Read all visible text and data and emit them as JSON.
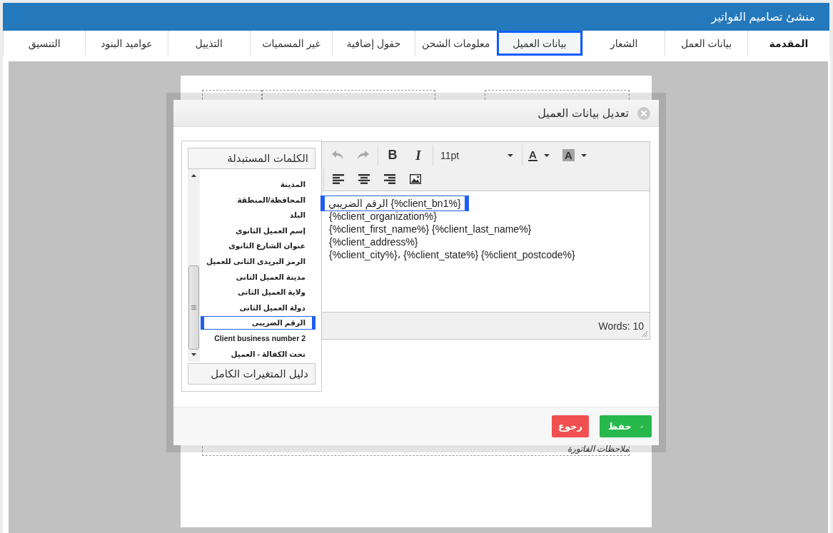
{
  "header": {
    "title": "منشئ تصاميم الفواتير"
  },
  "tabs": [
    {
      "label": "المقدمة",
      "kind": "heading",
      "selected": false
    },
    {
      "label": "بيانات العمل",
      "kind": "tab",
      "selected": false
    },
    {
      "label": "الشعار",
      "kind": "tab",
      "selected": false
    },
    {
      "label": "بيانات العميل",
      "kind": "tab",
      "selected": true
    },
    {
      "label": "معلومات الشحن",
      "kind": "tab",
      "selected": false
    },
    {
      "label": "حقول إضافية",
      "kind": "tab",
      "selected": false
    },
    {
      "label": "غير المسميات",
      "kind": "tab",
      "selected": false
    },
    {
      "label": "التذييل",
      "kind": "tab",
      "selected": false
    },
    {
      "label": "عواميد البنود",
      "kind": "tab",
      "selected": false
    },
    {
      "label": "التنسيق",
      "kind": "tab",
      "selected": false
    }
  ],
  "preview": {
    "notes_label": "ملاحظات الفاتورة"
  },
  "dialog": {
    "title": "تعديل بيانات العميل",
    "variables": {
      "heading": "الكلمات المستبدلة",
      "items": [
        {
          "label": "المدينة",
          "selected": false
        },
        {
          "label": "المحافظة/المنطقة",
          "selected": false
        },
        {
          "label": "البلد",
          "selected": false
        },
        {
          "label": "إسم العميل الثانوى",
          "selected": false
        },
        {
          "label": "عنوان الشارع الثانوى",
          "selected": false
        },
        {
          "label": "الرمز البريدى الثانى للعميل",
          "selected": false
        },
        {
          "label": "مدينة العميل الثانى",
          "selected": false
        },
        {
          "label": "ولاية العميل الثانى",
          "selected": false
        },
        {
          "label": "دولة العميل الثانى",
          "selected": false
        },
        {
          "label": "الرقم الضريبى",
          "selected": true
        },
        {
          "label": "Client business number 2",
          "selected": false
        },
        {
          "label": "تحت الكفالة - العميل",
          "selected": false
        }
      ],
      "guide_button": "دليل المتغيرات الكامل"
    },
    "editor": {
      "toolbar": [
        {
          "groups": [
            [
              {
                "kind": "background_color",
                "label": "A",
                "disabled": false
              },
              {
                "kind": "text_color",
                "label": "A",
                "disabled": false
              }
            ],
            [
              {
                "kind": "font_size",
                "value": "11pt",
                "disabled": false
              }
            ],
            [
              {
                "kind": "italic",
                "label": "I",
                "disabled": false
              },
              {
                "kind": "bold",
                "label": "B",
                "disabled": false
              }
            ],
            [
              {
                "kind": "redo",
                "disabled": true
              },
              {
                "kind": "undo",
                "disabled": true
              }
            ]
          ]
        },
        {
          "groups": [
            [
              {
                "kind": "image",
                "disabled": false
              },
              {
                "kind": "align_right",
                "disabled": false
              },
              {
                "kind": "align_center",
                "disabled": false
              },
              {
                "kind": "align_left",
                "disabled": false
              }
            ]
          ]
        }
      ],
      "lines": [
        {
          "text": "الرقم الضريبي {%client_bn1%}",
          "highlighted": true
        },
        {
          "text": "{%client_organization%}",
          "highlighted": false
        },
        {
          "text": "{%client_first_name%} {%client_last_name%}",
          "highlighted": false
        },
        {
          "text": "{%client_address%}",
          "highlighted": false
        },
        {
          "text": "{%client_city%}، {%client_state%} {%client_postcode%}",
          "highlighted": false
        }
      ],
      "word_count": "Words: 10"
    },
    "buttons": [
      {
        "kind": "save",
        "label": "حفظ"
      },
      {
        "kind": "back",
        "label": "رجوع"
      }
    ]
  }
}
